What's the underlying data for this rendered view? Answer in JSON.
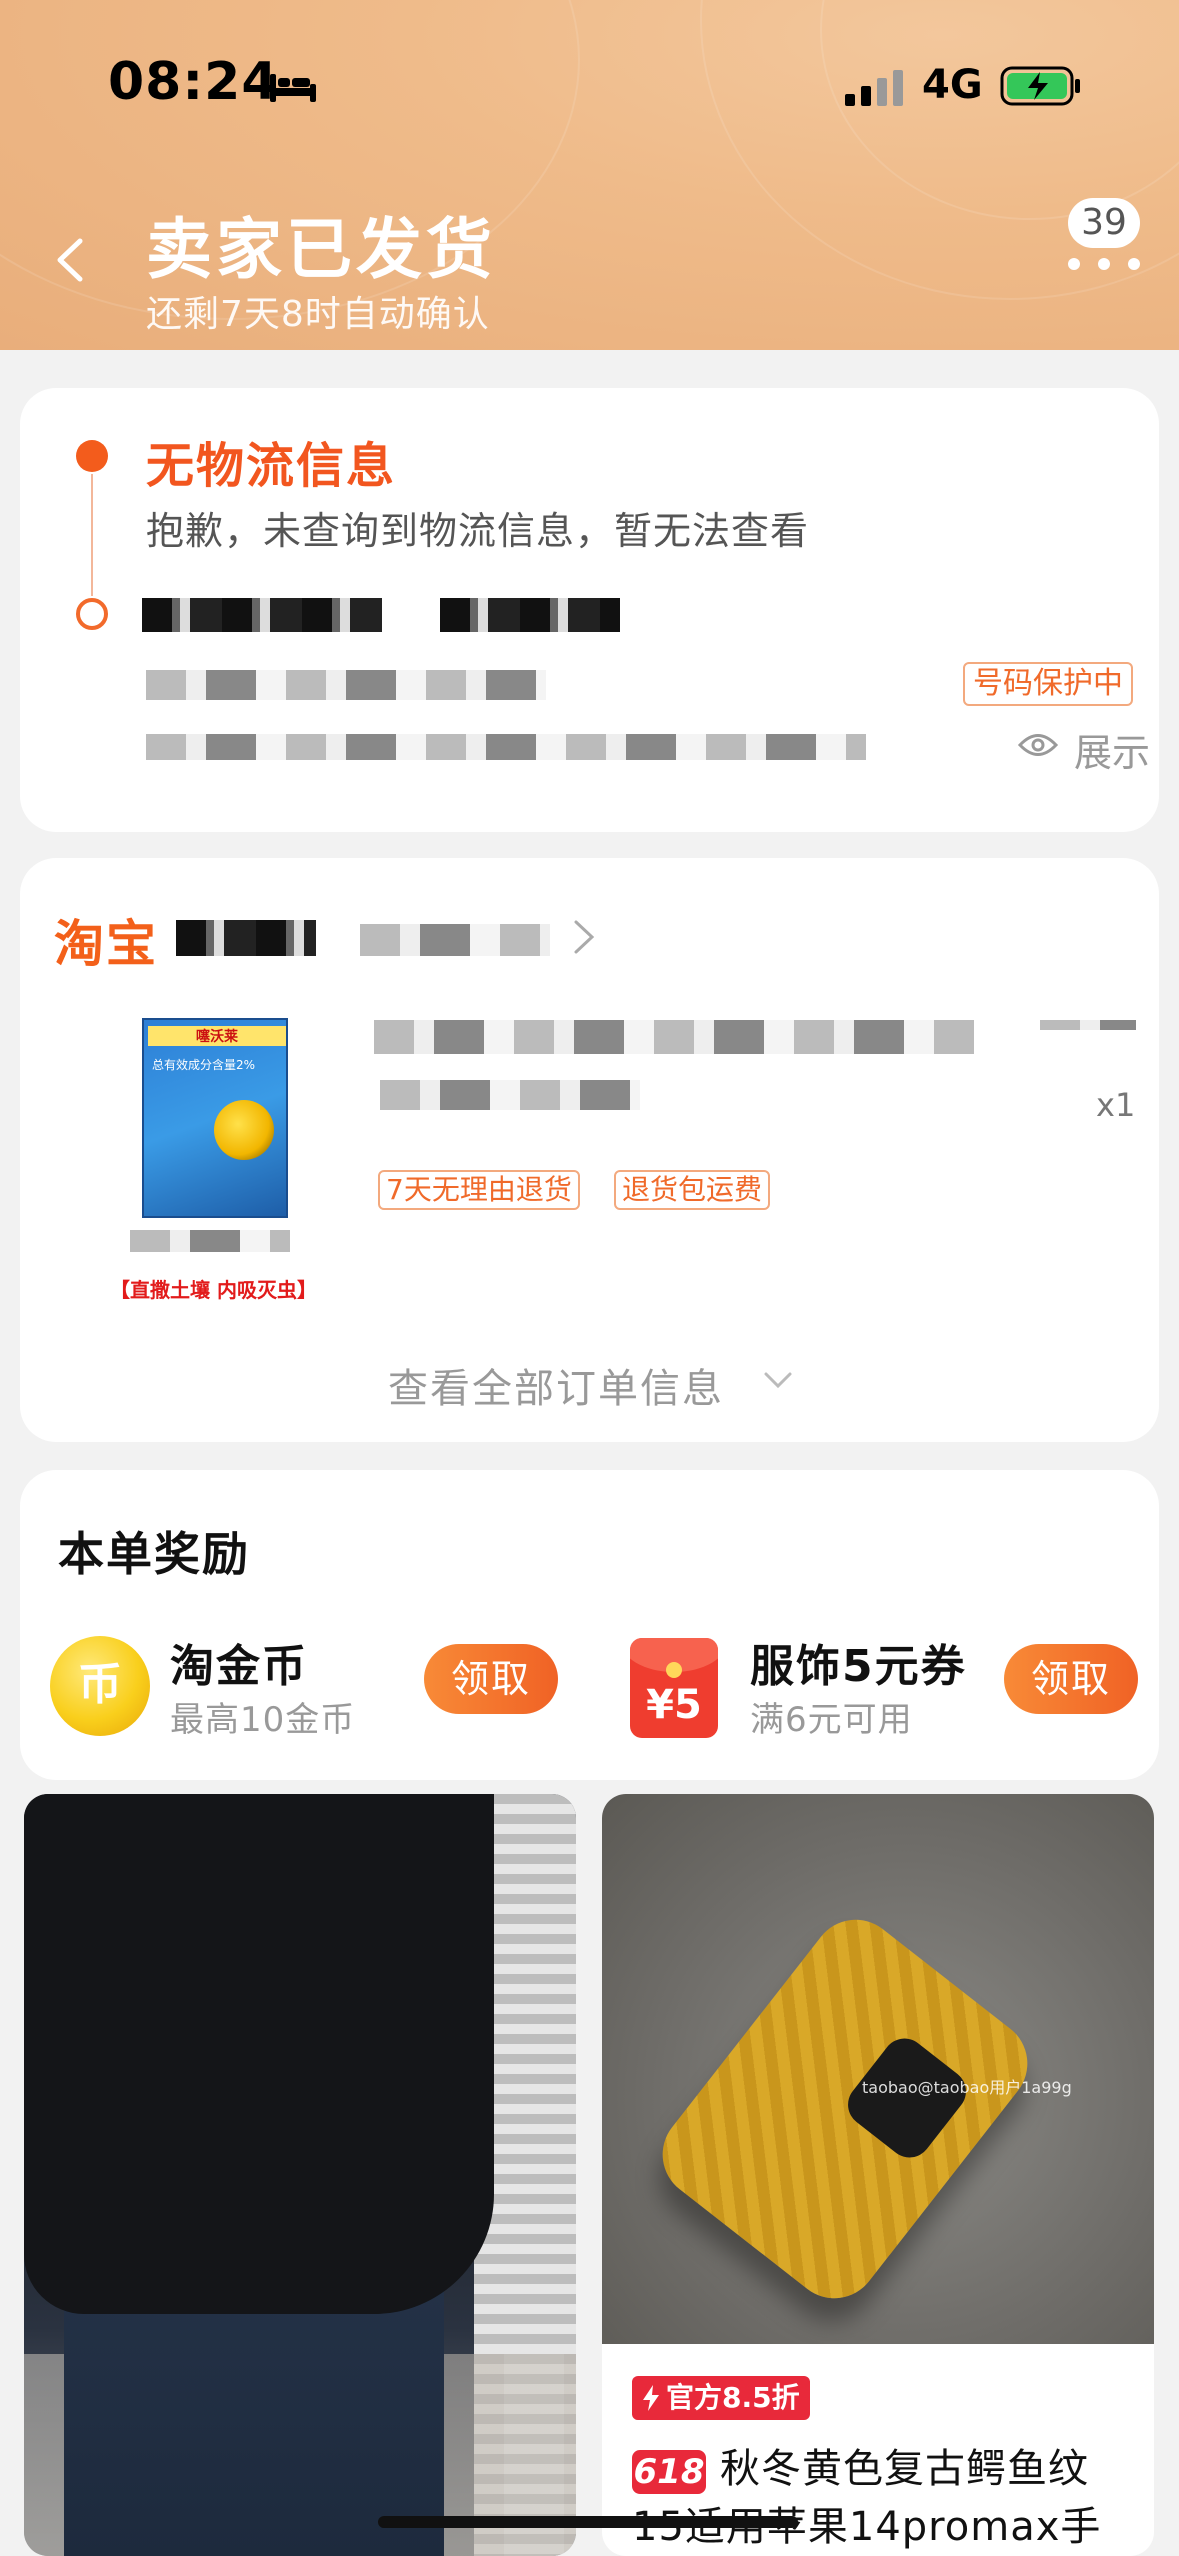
{
  "status_bar": {
    "time": "08:24",
    "network": "4G"
  },
  "header": {
    "title": "卖家已发货",
    "subtitle": "还剩7天8时自动确认",
    "message_count": "39"
  },
  "logistics": {
    "title": "无物流信息",
    "description": "抱歉，未查询到物流信息，暂无法查看",
    "phone_protect": "号码保护中",
    "show_label": "展示"
  },
  "order": {
    "platform": "淘宝",
    "product_caption": "【直撒土壤 内吸灭虫】",
    "product_pack_brand": "噻沃莱",
    "product_pack_text": "总有效成分含量2%",
    "quantity": "x1",
    "tags": [
      "7天无理由退货",
      "退货包运费"
    ],
    "view_all": "查看全部订单信息"
  },
  "rewards": {
    "title": "本单奖励",
    "items": [
      {
        "name": "淘金币",
        "desc": "最高10金币",
        "button": "领取",
        "icon": "gold-coin-icon"
      },
      {
        "name": "服饰5元券",
        "desc": "满6元可用",
        "button": "领取",
        "icon": "red-packet-icon",
        "icon_text": "¥5"
      }
    ]
  },
  "feed": {
    "item2": {
      "watermark": "taobao@taobao用户1a99g",
      "promo_tag": "官方8.5折",
      "badge": "618",
      "title": "秋冬黄色复古鳄鱼纹15适用苹果14promax手"
    }
  },
  "colors": {
    "accent": "#f2561f",
    "header_bg": "#efbb8a",
    "button": "#f06225"
  }
}
